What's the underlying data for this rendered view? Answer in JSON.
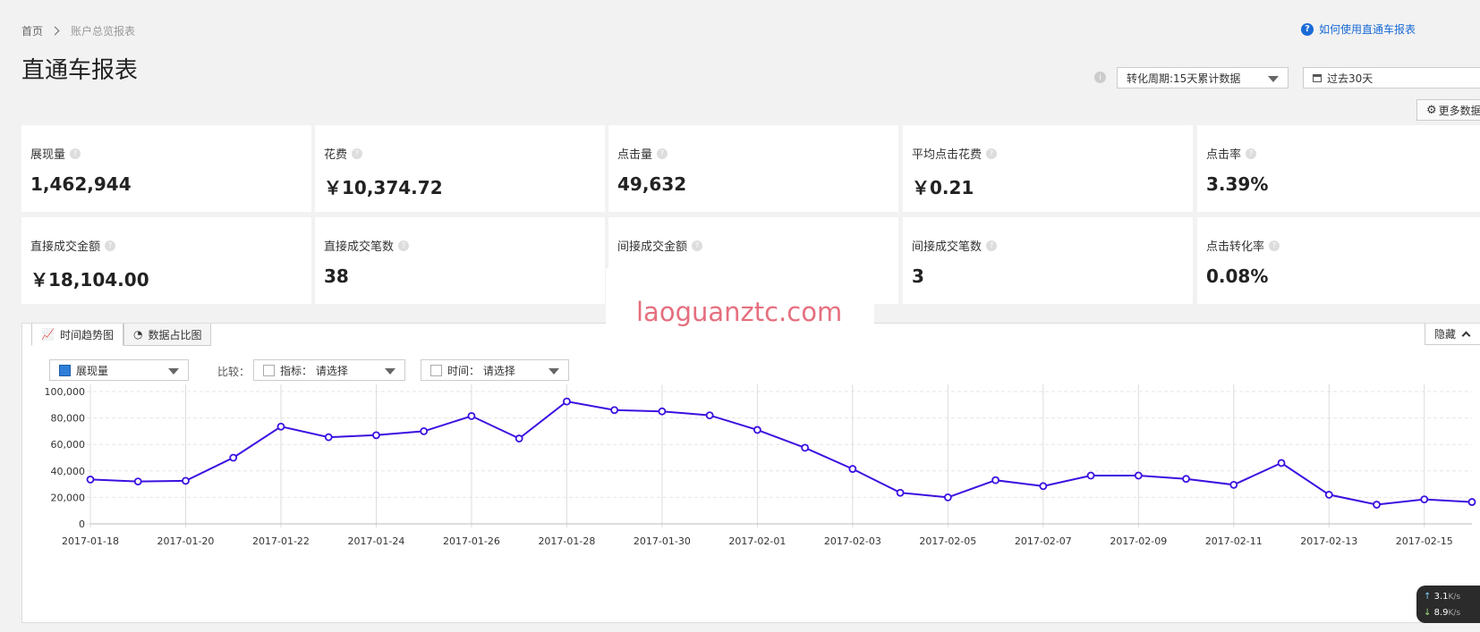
{
  "breadcrumb": {
    "home": "首页",
    "current": "账户总览报表"
  },
  "help_link": "如何使用直通车报表",
  "page_title": "直通车报表",
  "toolbar": {
    "period_select": "转化周期:15天累计数据",
    "date_select": "过去30天",
    "more_data": "更多数据"
  },
  "metrics": [
    {
      "label": "展现量",
      "value": "1,462,944"
    },
    {
      "label": "花费",
      "value": "￥10,374.72"
    },
    {
      "label": "点击量",
      "value": "49,632"
    },
    {
      "label": "平均点击花费",
      "value": "￥0.21"
    },
    {
      "label": "点击率",
      "value": "3.39%"
    },
    {
      "label": "直接成交金额",
      "value": "￥18,104.00"
    },
    {
      "label": "直接成交笔数",
      "value": "38"
    },
    {
      "label": "间接成交金额",
      "value": ""
    },
    {
      "label": "间接成交笔数",
      "value": "3"
    },
    {
      "label": "点击转化率",
      "value": "0.08%"
    }
  ],
  "watermark": "laoguanztc.com",
  "chart_panel": {
    "tab_trend": "时间趋势图",
    "tab_ratio": "数据占比图",
    "hide": "隐藏",
    "series_select": "展现量",
    "compare_label": "比较：",
    "compare_metric": "指标： 请选择",
    "compare_time": "时间： 请选择"
  },
  "chart_data": {
    "type": "line",
    "title": "",
    "xlabel": "",
    "ylabel": "",
    "ylim": [
      0,
      100000
    ],
    "yticks": [
      "0",
      "20,000",
      "40,000",
      "60,000",
      "80,000",
      "100,000"
    ],
    "x_tick_labels": [
      "2017-01-18",
      "2017-01-20",
      "2017-01-22",
      "2017-01-24",
      "2017-01-26",
      "2017-01-28",
      "2017-01-30",
      "2017-02-01",
      "2017-02-03",
      "2017-02-05",
      "2017-02-07",
      "2017-02-09",
      "2017-02-11",
      "2017-02-13",
      "2017-02-15"
    ],
    "x": [
      "2017-01-18",
      "2017-01-19",
      "2017-01-20",
      "2017-01-21",
      "2017-01-22",
      "2017-01-23",
      "2017-01-24",
      "2017-01-25",
      "2017-01-26",
      "2017-01-27",
      "2017-01-28",
      "2017-01-29",
      "2017-01-30",
      "2017-01-31",
      "2017-02-01",
      "2017-02-02",
      "2017-02-03",
      "2017-02-04",
      "2017-02-05",
      "2017-02-06",
      "2017-02-07",
      "2017-02-08",
      "2017-02-09",
      "2017-02-10",
      "2017-02-11",
      "2017-02-12",
      "2017-02-13",
      "2017-02-14",
      "2017-02-15",
      "2017-02-16"
    ],
    "series": [
      {
        "values": [
          33500,
          32000,
          32500,
          50000,
          73500,
          65500,
          67000,
          70000,
          81500,
          64500,
          92500,
          86000,
          85000,
          82000,
          71000,
          57500,
          41500,
          23500,
          20000,
          33000,
          28500,
          36500,
          36500,
          34000,
          29500,
          46000,
          22000,
          14500,
          18500,
          16500
        ]
      }
    ],
    "grid": true,
    "colors": {
      "line": "#3b10e0",
      "marker_fill": "#ffffff"
    }
  },
  "net_widget": {
    "up": "3.1",
    "down": "8.9",
    "unit": "K/s"
  }
}
